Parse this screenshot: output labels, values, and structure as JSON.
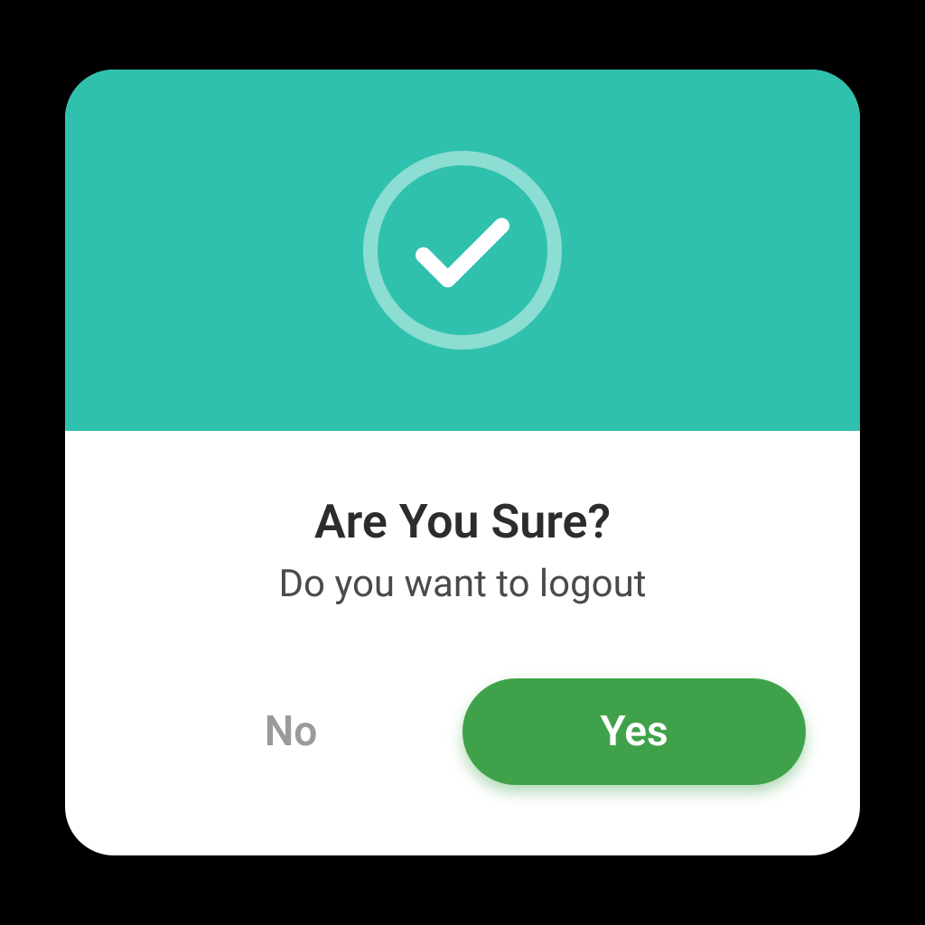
{
  "dialog": {
    "title": "Are You Sure?",
    "message": "Do you want to logout",
    "actions": {
      "no_label": "No",
      "yes_label": "Yes"
    }
  },
  "colors": {
    "header_bg": "#2fc1ad",
    "yes_bg": "#3fa24a",
    "no_text": "#9a9a9a"
  },
  "icons": {
    "header_icon": "checkmark-circle-icon"
  }
}
